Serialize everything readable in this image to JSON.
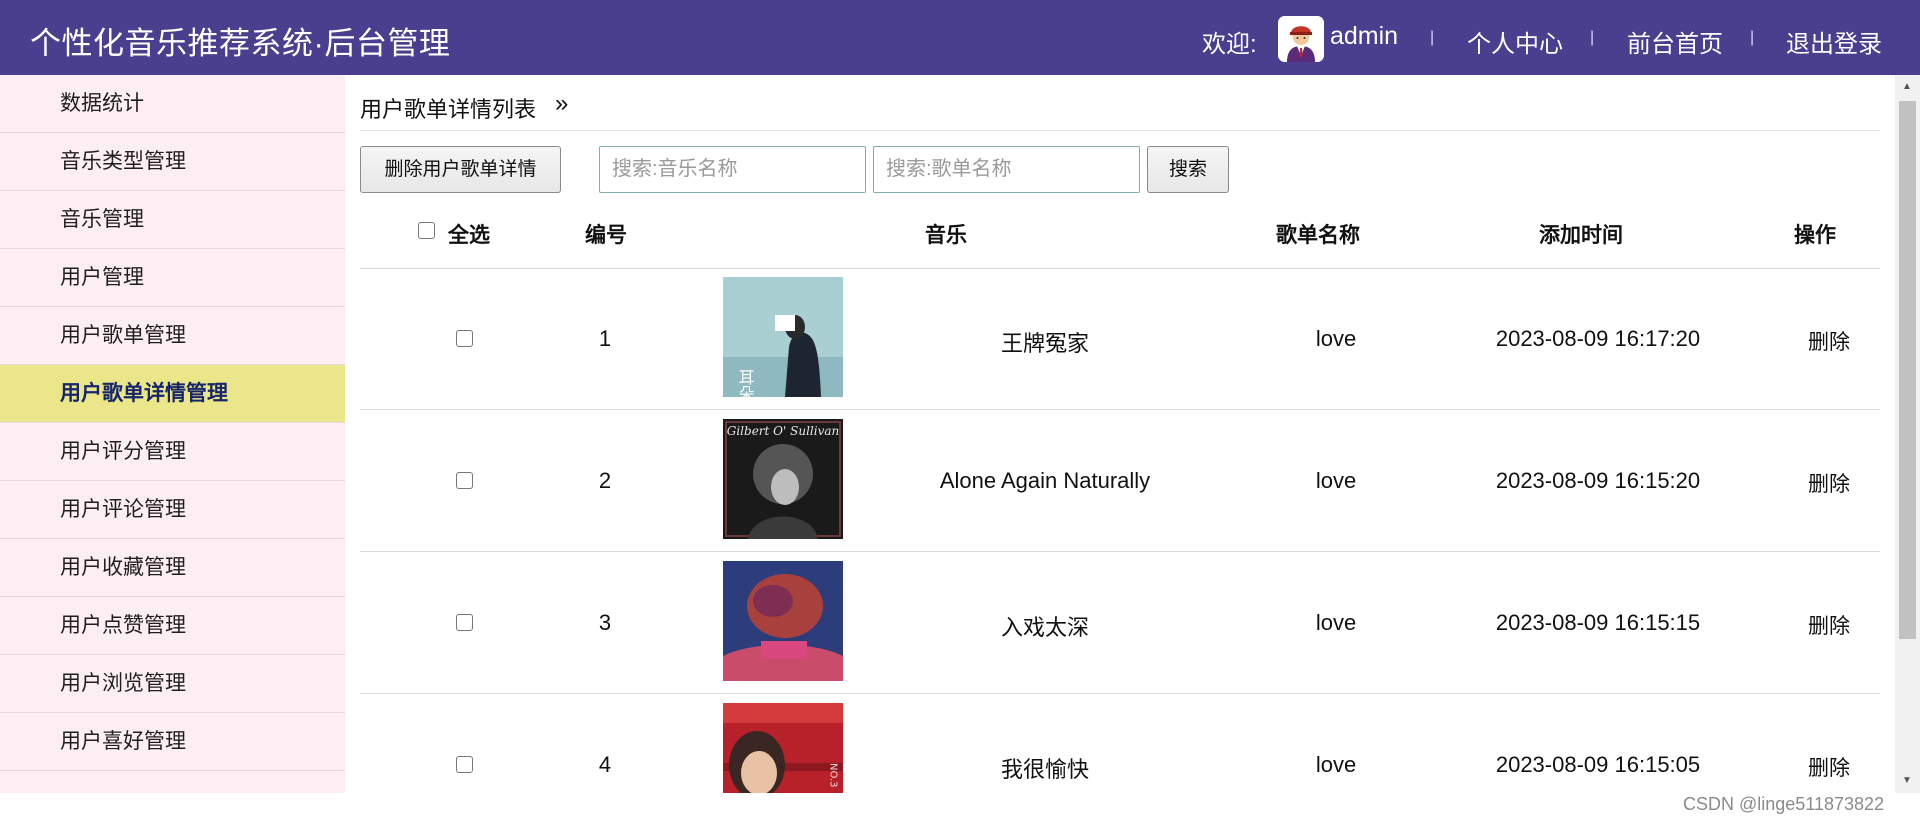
{
  "header": {
    "brand": "个性化音乐推荐系统·后台管理",
    "welcome_label": "欢迎:",
    "username": "admin",
    "separator": "|",
    "nav": [
      "个人中心",
      "前台首页",
      "退出登录"
    ]
  },
  "sidebar": {
    "items": [
      {
        "label": "数据统计"
      },
      {
        "label": "音乐类型管理"
      },
      {
        "label": "音乐管理"
      },
      {
        "label": "用户管理"
      },
      {
        "label": "用户歌单管理"
      },
      {
        "label": "用户歌单详情管理",
        "active": true
      },
      {
        "label": "用户评分管理"
      },
      {
        "label": "用户评论管理"
      },
      {
        "label": "用户收藏管理"
      },
      {
        "label": "用户点赞管理"
      },
      {
        "label": "用户浏览管理"
      },
      {
        "label": "用户喜好管理"
      }
    ]
  },
  "main": {
    "breadcrumb": "用户歌单详情列表",
    "breadcrumb_arrow": "»",
    "toolbar": {
      "delete_button": "删除用户歌单详情",
      "search_music_placeholder": "搜索:音乐名称",
      "search_playlist_placeholder": "搜索:歌单名称",
      "search_button": "搜索"
    },
    "table": {
      "columns": {
        "select_all": "全选",
        "id": "编号",
        "music": "音乐",
        "playlist": "歌单名称",
        "added_time": "添加时间",
        "action": "操作"
      },
      "rows": [
        {
          "id": "1",
          "music": "王牌冤家",
          "playlist": "love",
          "added_time": "2023-08-09 16:17:20",
          "action": "删除",
          "cover_text": "耳朵"
        },
        {
          "id": "2",
          "music": "Alone Again Naturally",
          "playlist": "love",
          "added_time": "2023-08-09 16:15:20",
          "action": "删除",
          "cover_text": "Gilbert O' Sullivan"
        },
        {
          "id": "3",
          "music": "入戏太深",
          "playlist": "love",
          "added_time": "2023-08-09 16:15:15",
          "action": "删除",
          "cover_text": ""
        },
        {
          "id": "4",
          "music": "我很愉快",
          "playlist": "love",
          "added_time": "2023-08-09 16:15:05",
          "action": "删除",
          "cover_text": "NO.3"
        }
      ]
    }
  },
  "watermark": "CSDN @linge511873822",
  "colors": {
    "header_bg": "#4a3f8f",
    "sidebar_bg": "#fdeef3",
    "sidebar_active_bg": "#ece68a",
    "sidebar_active_text": "#17266b"
  }
}
